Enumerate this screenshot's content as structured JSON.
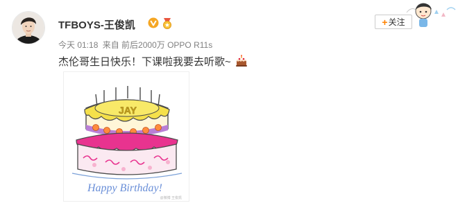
{
  "user": {
    "name": "TFBOYS-王俊凯"
  },
  "meta": {
    "time": "今天 01:18",
    "source": "来自 前后2000万 OPPO R11s"
  },
  "post": {
    "text": "杰伦哥生日快乐！下课啦我要去听歌~"
  },
  "image": {
    "cake_label": "JAY",
    "caption": "Happy Birthday!",
    "watermark": "@微博 王俊凯"
  },
  "follow": {
    "label": "关注"
  },
  "colors": {
    "accent": "#ff8200",
    "text": "#333333",
    "meta": "#808080",
    "cake_yellow": "#f5e04a",
    "cake_pink": "#e8338f",
    "caption_blue": "#6a8fd8"
  },
  "icons": [
    "verified-v-icon",
    "medal-icon",
    "cake-emoji-icon",
    "plus-icon"
  ]
}
